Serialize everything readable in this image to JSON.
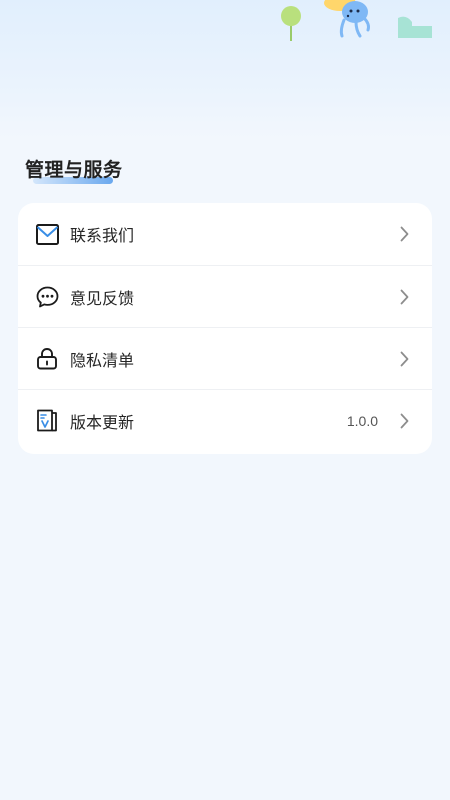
{
  "section": {
    "title": "管理与服务"
  },
  "menu": {
    "items": [
      {
        "label": "联系我们",
        "icon": "mail-icon",
        "value": ""
      },
      {
        "label": "意见反馈",
        "icon": "chat-bubble-icon",
        "value": ""
      },
      {
        "label": "隐私清单",
        "icon": "lock-icon",
        "value": ""
      },
      {
        "label": "版本更新",
        "icon": "version-document-icon",
        "value": "1.0.0"
      }
    ]
  },
  "colors": {
    "background": "#f2f7fd",
    "accent": "#6aa8ee",
    "card": "#ffffff",
    "text": "#262626"
  }
}
